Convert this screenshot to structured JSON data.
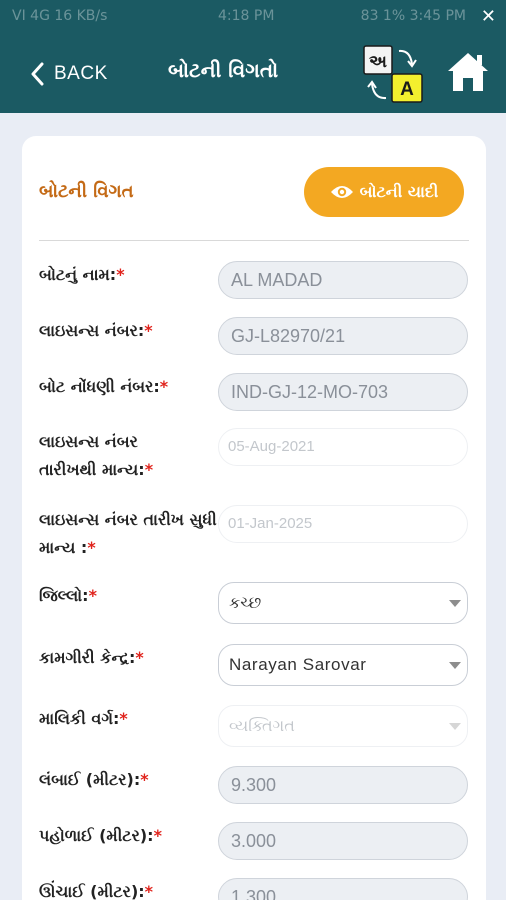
{
  "status_bar": {
    "carrier": "VI 4G 16 KB/s",
    "time": "4:18 PM",
    "battery": "83 1% 3:45 PM"
  },
  "app_bar": {
    "back_label": "BACK",
    "title": "બોટની વિગતો",
    "translate_glyph_gu": "અ",
    "translate_glyph_en": "A"
  },
  "colors": {
    "app_bar": "#1b5a63",
    "accent_orange": "#f3a822",
    "section_title": "#c46a16",
    "required": "#e0231c"
  },
  "section": {
    "title": "બોટની વિગત",
    "list_button": "બોટની યાદી"
  },
  "form": {
    "boat_name": {
      "label": "બોટનું નામ:",
      "value": "AL MADAD"
    },
    "license_no": {
      "label": "લાઇસન્સ નંબર:",
      "value": "GJ-L82970/21"
    },
    "reg_no": {
      "label": "બોટ નોંધણી નંબર:",
      "value": "IND-GJ-12-MO-703"
    },
    "valid_from": {
      "label": "લાઇસન્સ નંબર તારીખથી માન્ય:",
      "value": "05-Aug-2021"
    },
    "valid_to": {
      "label": "લાઇસન્સ નંબર તારીખ સુધી માન્ય :",
      "value": "01-Jan-2025"
    },
    "district": {
      "label": "જિલ્લો:",
      "value": "કચ્છ"
    },
    "work_center": {
      "label": "કામગીરી કેન્દ્ર:",
      "value": "Narayan Sarovar"
    },
    "owner_type": {
      "label": "માલિકી વર્ગ:",
      "value": "વ્યક્તિગત"
    },
    "length": {
      "label": "લંબાઈ (મીટર):",
      "value": "9.300"
    },
    "width": {
      "label": "પહોળાઈ (મીટર):",
      "value": "3.000"
    },
    "height": {
      "label": "ઊંચાઈ (મીટર):",
      "value": "1.300"
    },
    "required_mark": "*"
  }
}
